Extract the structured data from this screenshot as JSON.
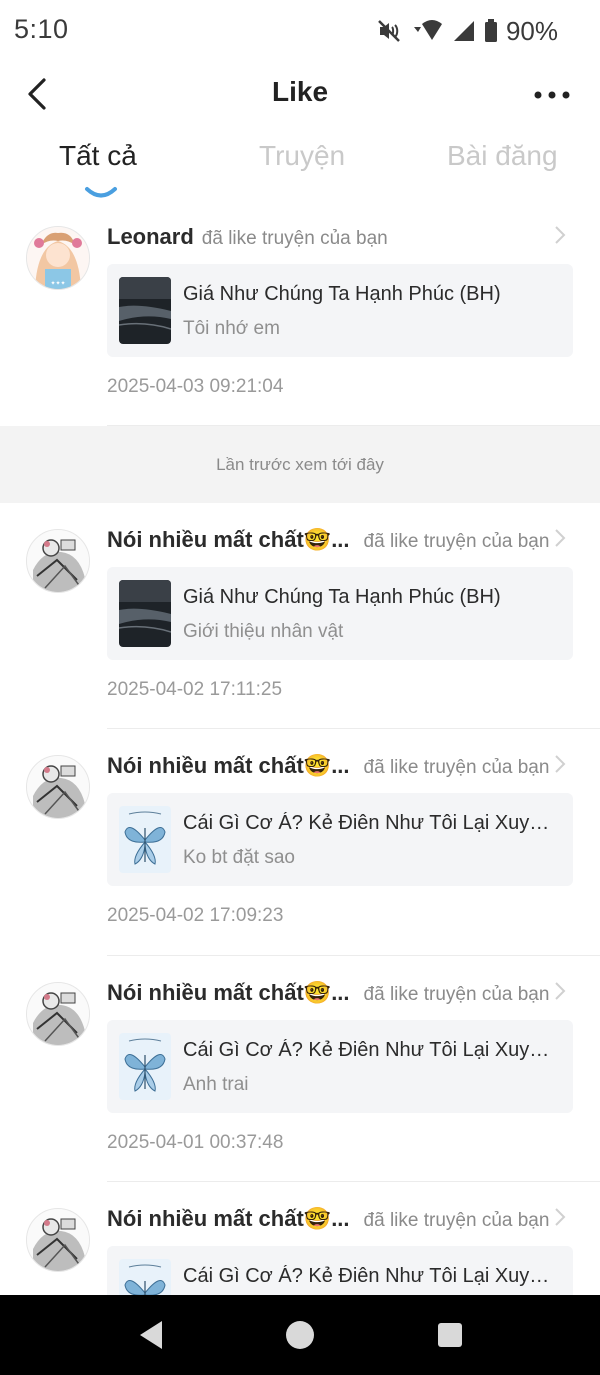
{
  "status_bar": {
    "time": "5:10",
    "battery": "90%",
    "icons": [
      "mute-icon",
      "wifi-icon",
      "signal-icon",
      "battery-icon"
    ]
  },
  "header": {
    "title": "Like",
    "back_icon": "chevron-left-icon",
    "more_icon": "more-horizontal-icon"
  },
  "tabs": [
    {
      "label": "Tất cả",
      "active": true
    },
    {
      "label": "Truyện",
      "active": false
    },
    {
      "label": "Bài đăng",
      "active": false
    }
  ],
  "items": [
    {
      "user": "Leonard",
      "action": "đã like truyện của bạn",
      "story_title": "Giá Như Chúng Ta Hạnh Phúc (BH)",
      "chapter": "Tôi nhớ em",
      "time": "2025-04-03 09:21:04"
    },
    {
      "user": "Nói nhiều mất chất🤓...",
      "action": "đã like truyện của bạn",
      "story_title": "Giá Như Chúng Ta Hạnh Phúc (BH)",
      "chapter": "Giới thiệu nhân vật",
      "time": "2025-04-02 17:11:25"
    },
    {
      "user": "Nói nhiều mất chất🤓...",
      "action": "đã like truyện của bạn",
      "story_title": "Cái Gì Cơ Á? Kẻ Điên Như Tôi Lại Xuyên ...",
      "chapter": "Ko bt đặt sao",
      "time": "2025-04-02 17:09:23"
    },
    {
      "user": "Nói nhiều mất chất🤓...",
      "action": "đã like truyện của bạn",
      "story_title": "Cái Gì Cơ Á? Kẻ Điên Như Tôi Lại Xuyên ...",
      "chapter": "Anh trai",
      "time": "2025-04-01 00:37:48"
    },
    {
      "user": "Nói nhiều mất chất🤓...",
      "action": "đã like truyện của bạn",
      "story_title": "Cái Gì Cơ Á? Kẻ Điên Như Tôi Lại Xuyên ...",
      "chapter": "",
      "time": ""
    }
  ],
  "last_seen_label": "Lần trước xem tới đây",
  "colors": {
    "accent": "#4a9fe0",
    "card_bg": "#f4f5f7",
    "muted": "#8a8a8a"
  },
  "nav": {
    "back": "nav-back-icon",
    "home": "nav-home-icon",
    "recents": "nav-recents-icon"
  }
}
